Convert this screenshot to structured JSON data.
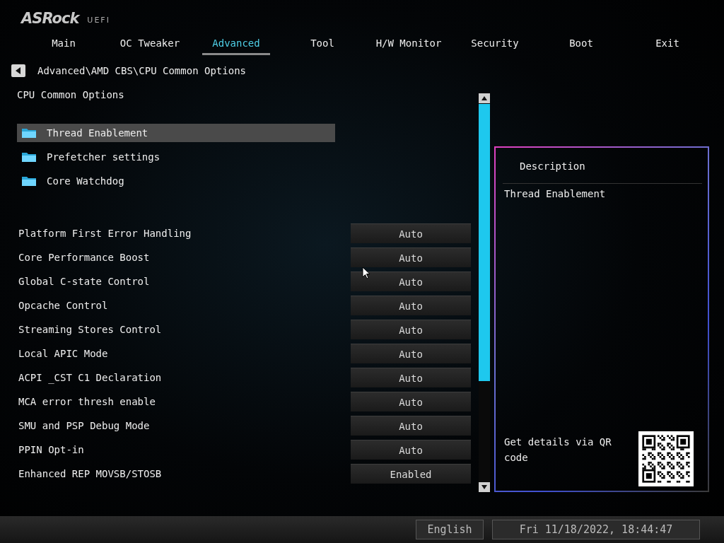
{
  "logo": {
    "brand": "ASRock",
    "product": "UEFI"
  },
  "tabs": [
    {
      "label": "Main",
      "selected": false
    },
    {
      "label": "OC Tweaker",
      "selected": false
    },
    {
      "label": "Advanced",
      "selected": true
    },
    {
      "label": "Tool",
      "selected": false
    },
    {
      "label": "H/W Monitor",
      "selected": false
    },
    {
      "label": "Security",
      "selected": false
    },
    {
      "label": "Boot",
      "selected": false
    },
    {
      "label": "Exit",
      "selected": false
    }
  ],
  "breadcrumb": "Advanced\\AMD CBS\\CPU Common Options",
  "section_title": "CPU Common Options",
  "submenus": [
    {
      "label": "Thread Enablement",
      "selected": true
    },
    {
      "label": "Prefetcher settings",
      "selected": false
    },
    {
      "label": "Core Watchdog",
      "selected": false
    }
  ],
  "settings": [
    {
      "label": "Platform First Error Handling",
      "value": "Auto"
    },
    {
      "label": "Core Performance Boost",
      "value": "Auto"
    },
    {
      "label": "Global C-state Control",
      "value": "Auto"
    },
    {
      "label": "Opcache Control",
      "value": "Auto"
    },
    {
      "label": "Streaming Stores Control",
      "value": "Auto"
    },
    {
      "label": "Local APIC Mode",
      "value": "Auto"
    },
    {
      "label": "ACPI _CST C1 Declaration",
      "value": "Auto"
    },
    {
      "label": "MCA error thresh enable",
      "value": "Auto"
    },
    {
      "label": "SMU and PSP Debug Mode",
      "value": "Auto"
    },
    {
      "label": "PPIN Opt-in",
      "value": "Auto"
    },
    {
      "label": "Enhanced REP MOVSB/STOSB",
      "value": "Enabled"
    }
  ],
  "description": {
    "title": "Description",
    "text": "Thread Enablement",
    "qr_caption": "Get details via QR code"
  },
  "status_bar": {
    "language": "English",
    "datetime": "Fri 11/18/2022, 18:44:47"
  }
}
